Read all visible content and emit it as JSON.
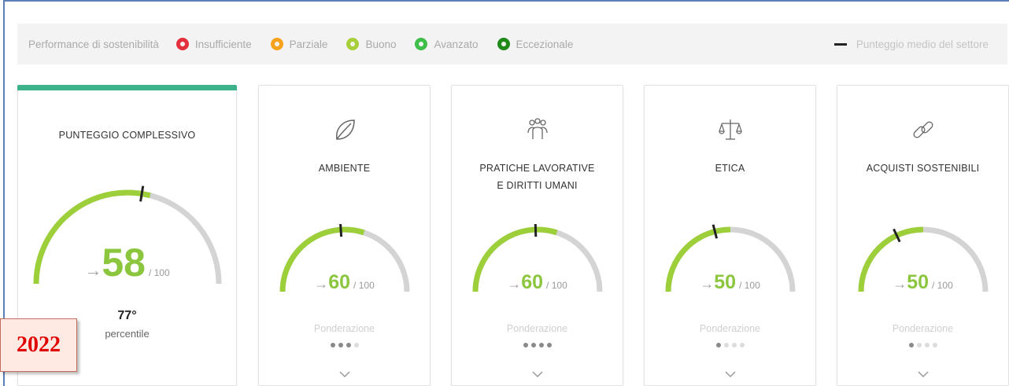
{
  "legend": {
    "title": "Performance di sostenibilità",
    "items": [
      {
        "label": "Insufficiente",
        "color": "#e3303c"
      },
      {
        "label": "Parziale",
        "color": "#f7a21b"
      },
      {
        "label": "Buono",
        "color": "#a9cf38"
      },
      {
        "label": "Avanzato",
        "color": "#3fbf4a"
      },
      {
        "label": "Eccezionale",
        "color": "#1f8a17"
      }
    ],
    "avg_label": "Punteggio medio del settore"
  },
  "overall": {
    "title": "PUNTEGGIO COMPLESSIVO",
    "score": "58",
    "max": "/ 100",
    "arrow": "→",
    "percentile_value": "77°",
    "percentile_label": "percentile",
    "score_fraction": 0.58,
    "sector_avg_fraction": 0.55
  },
  "categories": [
    {
      "title_line1": "AMBIENTE",
      "title_line2": "",
      "icon": "leaf-icon",
      "score": "60",
      "max": "/ 100",
      "arrow": "→",
      "weight_label": "Ponderazione",
      "weight_level": 3,
      "score_fraction": 0.6,
      "sector_avg_fraction": 0.48
    },
    {
      "title_line1": "PRATICHE LAVORATIVE",
      "title_line2": "E DIRITTI UMANI",
      "icon": "people-icon",
      "score": "60",
      "max": "/ 100",
      "arrow": "→",
      "weight_label": "Ponderazione",
      "weight_level": 4,
      "score_fraction": 0.6,
      "sector_avg_fraction": 0.49
    },
    {
      "title_line1": "ETICA",
      "title_line2": "",
      "icon": "scales-icon",
      "score": "50",
      "max": "/ 100",
      "arrow": "→",
      "weight_label": "Ponderazione",
      "weight_level": 1,
      "score_fraction": 0.5,
      "sector_avg_fraction": 0.42
    },
    {
      "title_line1": "ACQUISTI SOSTENIBILI",
      "title_line2": "",
      "icon": "link-icon",
      "score": "50",
      "max": "/ 100",
      "arrow": "→",
      "weight_label": "Ponderazione",
      "weight_level": 1,
      "score_fraction": 0.5,
      "sector_avg_fraction": 0.36
    }
  ],
  "badge": {
    "year": "2022"
  },
  "colors": {
    "gauge_fill": "#9ccf3a",
    "gauge_track": "#d4d4d4",
    "marker": "#222222",
    "topbar": "#3db18a",
    "score_text": "#8cc63f"
  }
}
